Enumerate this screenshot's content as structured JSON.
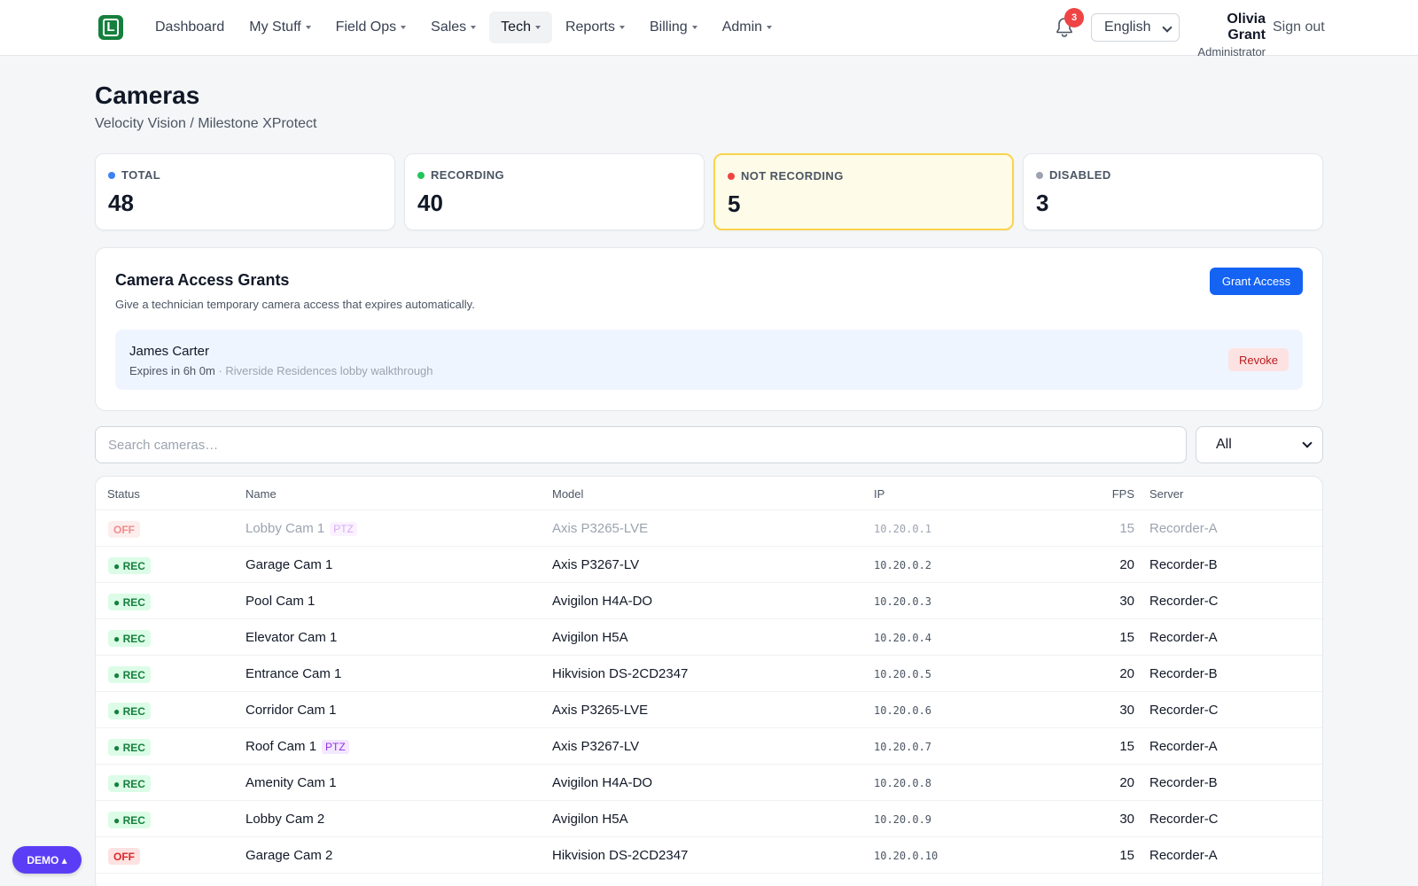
{
  "nav": {
    "logo_letter": "L",
    "items": [
      {
        "label": "Dashboard",
        "caret": false,
        "active": false
      },
      {
        "label": "My Stuff",
        "caret": true,
        "active": false
      },
      {
        "label": "Field Ops",
        "caret": true,
        "active": false
      },
      {
        "label": "Sales",
        "caret": true,
        "active": false
      },
      {
        "label": "Tech",
        "caret": true,
        "active": true
      },
      {
        "label": "Reports",
        "caret": true,
        "active": false
      },
      {
        "label": "Billing",
        "caret": true,
        "active": false
      },
      {
        "label": "Admin",
        "caret": true,
        "active": false
      }
    ],
    "notification_count": "3",
    "language": "English",
    "user_name": "Olivia Grant",
    "user_role": "Administrator",
    "signout_label": "Sign out"
  },
  "page": {
    "title": "Cameras",
    "subtitle": "Velocity Vision / Milestone XProtect"
  },
  "stats": [
    {
      "label": "TOTAL",
      "value": "48",
      "dot_color": "#3b82f6"
    },
    {
      "label": "RECORDING",
      "value": "40",
      "dot_color": "#22c55e"
    },
    {
      "label": "NOT RECORDING",
      "value": "5",
      "dot_color": "#ef4444"
    },
    {
      "label": "DISABLED",
      "value": "3",
      "dot_color": "#9ca3af"
    }
  ],
  "grants": {
    "title": "Camera Access Grants",
    "description": "Give a technician temporary camera access that expires automatically.",
    "button_label": "Grant Access",
    "items": [
      {
        "name": "James Carter",
        "expires": "Expires in 6h 0m",
        "separator": " · ",
        "note": "Riverside Residences lobby walkthrough",
        "revoke_label": "Revoke"
      }
    ]
  },
  "search": {
    "placeholder": "Search cameras…",
    "filter_value": "All"
  },
  "table": {
    "columns": [
      "Status",
      "Name",
      "Model",
      "IP",
      "FPS",
      "Server"
    ],
    "rows": [
      {
        "status": "OFF",
        "name": "Lobby Cam 1",
        "ptz": "PTZ",
        "model": "Axis P3265-LVE",
        "ip": "10.20.0.1",
        "fps": "15",
        "server": "Recorder-A",
        "disabled": true
      },
      {
        "status": "● REC",
        "name": "Garage Cam 1",
        "ptz": "",
        "model": "Axis P3267-LV",
        "ip": "10.20.0.2",
        "fps": "20",
        "server": "Recorder-B",
        "disabled": false
      },
      {
        "status": "● REC",
        "name": "Pool Cam 1",
        "ptz": "",
        "model": "Avigilon H4A-DO",
        "ip": "10.20.0.3",
        "fps": "30",
        "server": "Recorder-C",
        "disabled": false
      },
      {
        "status": "● REC",
        "name": "Elevator Cam 1",
        "ptz": "",
        "model": "Avigilon H5A",
        "ip": "10.20.0.4",
        "fps": "15",
        "server": "Recorder-A",
        "disabled": false
      },
      {
        "status": "● REC",
        "name": "Entrance Cam 1",
        "ptz": "",
        "model": "Hikvision DS-2CD2347",
        "ip": "10.20.0.5",
        "fps": "20",
        "server": "Recorder-B",
        "disabled": false
      },
      {
        "status": "● REC",
        "name": "Corridor Cam 1",
        "ptz": "",
        "model": "Axis P3265-LVE",
        "ip": "10.20.0.6",
        "fps": "30",
        "server": "Recorder-C",
        "disabled": false
      },
      {
        "status": "● REC",
        "name": "Roof Cam 1",
        "ptz": "PTZ",
        "model": "Axis P3267-LV",
        "ip": "10.20.0.7",
        "fps": "15",
        "server": "Recorder-A",
        "disabled": false
      },
      {
        "status": "● REC",
        "name": "Amenity Cam 1",
        "ptz": "",
        "model": "Avigilon H4A-DO",
        "ip": "10.20.0.8",
        "fps": "20",
        "server": "Recorder-B",
        "disabled": false
      },
      {
        "status": "● REC",
        "name": "Lobby Cam 2",
        "ptz": "",
        "model": "Avigilon H5A",
        "ip": "10.20.0.9",
        "fps": "30",
        "server": "Recorder-C",
        "disabled": false
      },
      {
        "status": "OFF",
        "name": "Garage Cam 2",
        "ptz": "",
        "model": "Hikvision DS-2CD2347",
        "ip": "10.20.0.10",
        "fps": "15",
        "server": "Recorder-A",
        "disabled": false
      }
    ]
  },
  "demo_label": "DEMO ▴",
  "colors": {
    "primary": "#1463f3",
    "brand": "#15803d",
    "rec": "#15803d",
    "off": "#dc2626",
    "ptz": "#9333ea",
    "demo": "#5b3df5"
  }
}
